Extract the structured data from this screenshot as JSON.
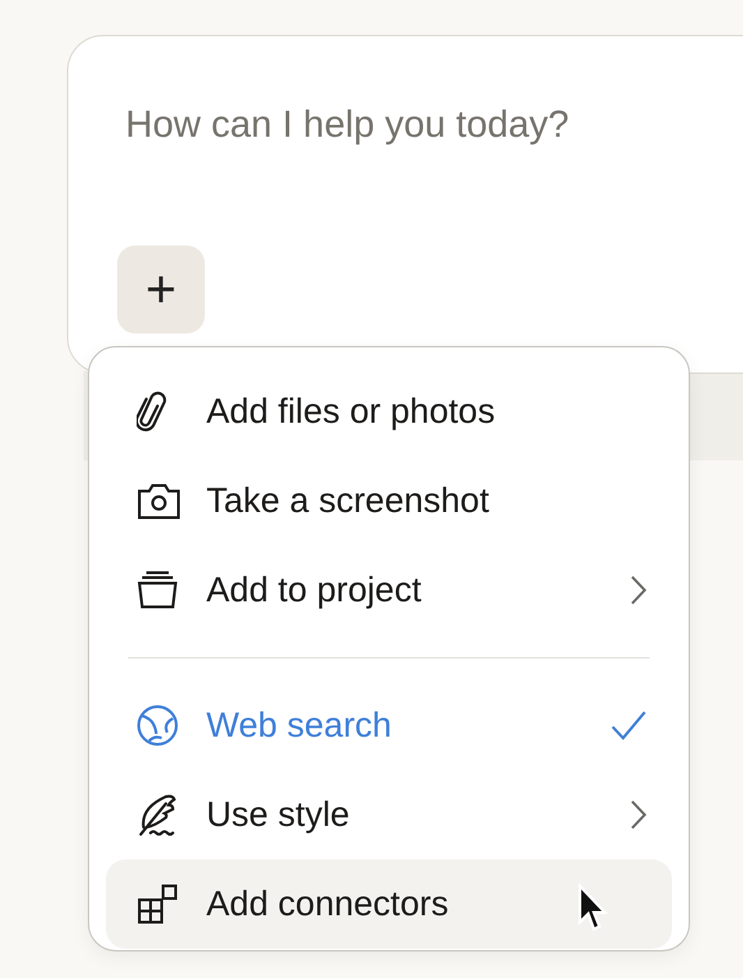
{
  "prompt": {
    "placeholder": "How can I help you today?",
    "add_button": "+"
  },
  "menu": {
    "sections": [
      [
        {
          "label": "Add files or photos",
          "has_submenu": false,
          "checked": false,
          "hovered": false
        },
        {
          "label": "Take a screenshot",
          "has_submenu": false,
          "checked": false,
          "hovered": false
        },
        {
          "label": "Add to project",
          "has_submenu": true,
          "checked": false,
          "hovered": false
        }
      ],
      [
        {
          "label": "Web search",
          "has_submenu": false,
          "checked": true,
          "hovered": false
        },
        {
          "label": "Use style",
          "has_submenu": true,
          "checked": false,
          "hovered": false
        },
        {
          "label": "Add connectors",
          "has_submenu": false,
          "checked": false,
          "hovered": true
        }
      ]
    ]
  }
}
